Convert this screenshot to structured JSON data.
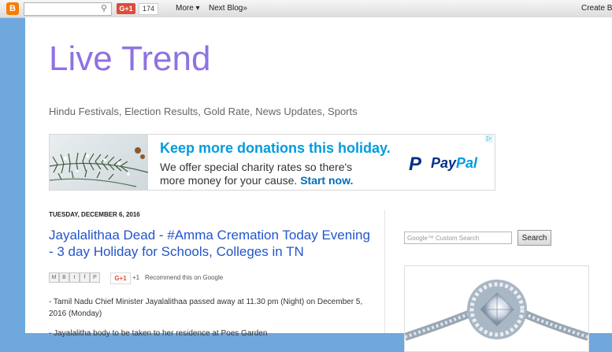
{
  "navbar": {
    "logo_letter": "B",
    "search_placeholder": "",
    "gplus_label": "G+1",
    "gplus_count": "174",
    "more_label": "More ▾",
    "next_blog_label": "Next Blog»",
    "create_label": "Create B"
  },
  "blog": {
    "title": "Live Trend",
    "description": "Hindu Festivals, Election Results, Gold Rate, News Updates, Sports"
  },
  "ad": {
    "headline": "Keep more donations this holiday.",
    "line1": "We offer special charity rates so there's",
    "line2_text": "more money for your cause.",
    "cta": "Start now.",
    "brand_pay": "Pay",
    "brand_pal": "Pal",
    "brand_mark": "P",
    "adchoices": "▷"
  },
  "post": {
    "date": "TUESDAY, DECEMBER 6, 2016",
    "title": "Jayalalithaa Dead - #Amma Cremation Today Evening - 3 day Holiday for Schools, Colleges in TN",
    "share": {
      "buttons": [
        "M",
        "B",
        "t",
        "f",
        "P"
      ],
      "gplus": "G+1",
      "plus_one": "+1",
      "recommend": "Recommend this on Google"
    },
    "paragraphs": [
      "- Tamil Nadu Chief Minister Jayalalithaa passed away at 11.30 pm (Night) on December 5, 2016 (Monday)",
      "- Jayalalitha body to be taken to her residence at Poes Garden"
    ]
  },
  "sidebar": {
    "search_placeholder": "Google™ Custom Search",
    "search_button": "Search"
  }
}
